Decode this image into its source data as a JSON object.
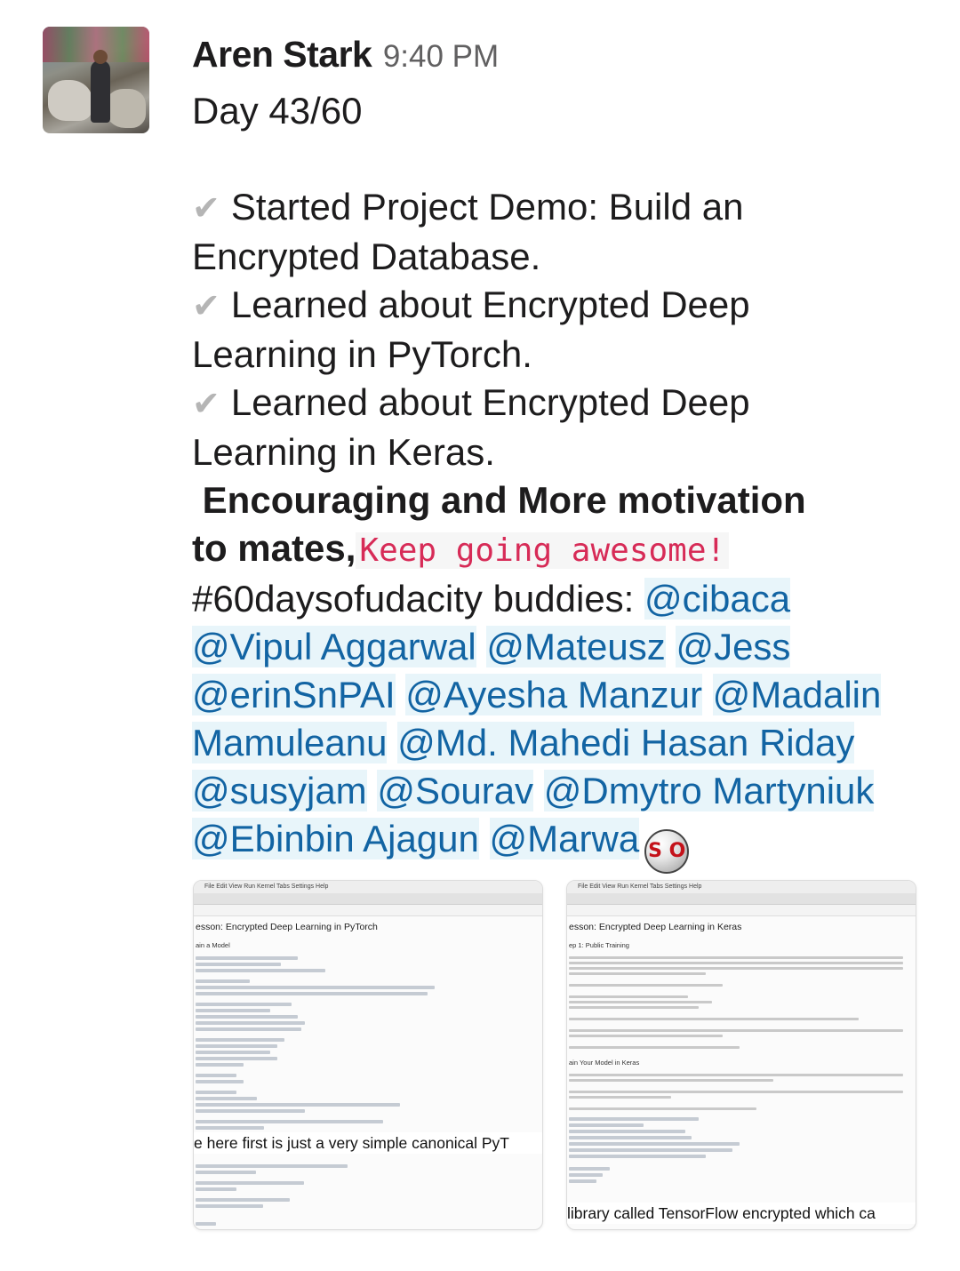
{
  "message": {
    "author": "Aren Stark",
    "time": "9:40 PM",
    "title": "Day 43/60",
    "checklist": [
      {
        "check": "✔",
        "line1": "Started Project Demo: Build an",
        "line2": "Encrypted Database."
      },
      {
        "check": "✔",
        "line1": "Learned about Encrypted Deep",
        "line2": "Learning in PyTorch."
      },
      {
        "check": "✔",
        "line1": "Learned about Encrypted Deep",
        "line2": "Learning in Keras."
      }
    ],
    "bold_line1": " Encouraging and More motivation",
    "bold_line2": "to mates,",
    "code_text": "Keep going awesome!",
    "hashtag_prefix": "#60daysofudacity buddies: ",
    "mentions": [
      "@cibaca",
      "@Vipul Aggarwal",
      "@Mateusz",
      "@Jess",
      "@erinSnPAI",
      "@Ayesha Manzur",
      "@Madalin",
      "Mamuleanu",
      "@Md. Mahedi Hasan Riday",
      "@susyjam",
      "@Sourav",
      "@Dmytro Martyniuk",
      "@Ebinbin Ajagun",
      "@Marwa"
    ],
    "emoji_text": "S O",
    "emoji_name": "sos-badge-icon"
  },
  "attachments": [
    {
      "menu": "File   Edit   View   Run   Kernel   Tabs   Settings   Help",
      "title": "esson: Encrypted Deep Learning in PyTorch",
      "subtitle": "ain a Model",
      "caption": "e here first is just a very simple canonical PyT"
    },
    {
      "menu": "File   Edit   View   Run   Kernel   Tabs   Settings   Help",
      "title": "esson: Encrypted Deep Learning in Keras",
      "subtitle": "ep 1: Public Training",
      "caption": "library called TensorFlow encrypted which ca"
    }
  ],
  "colors": {
    "mention": "#1264a3",
    "mention_bg": "#e8f5fa",
    "code": "#d72b57",
    "timestamp": "#616061"
  }
}
